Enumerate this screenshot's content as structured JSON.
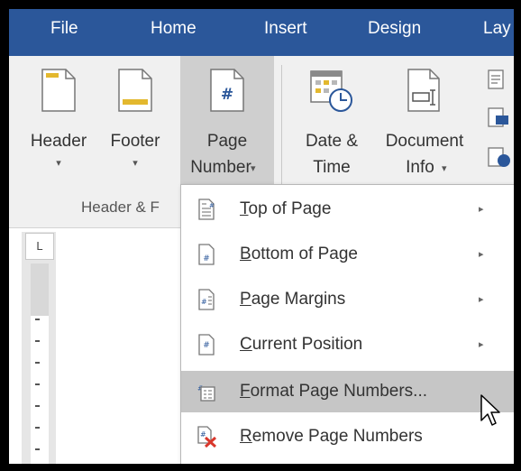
{
  "tabs": {
    "file": "File",
    "home": "Home",
    "insert": "Insert",
    "design": "Design",
    "layout": "Lay"
  },
  "ribbon": {
    "header": {
      "label": "Header"
    },
    "footer": {
      "label": "Footer"
    },
    "page_number": {
      "line1": "Page",
      "line2": "Number"
    },
    "date_time": {
      "line1": "Date &",
      "line2": "Time"
    },
    "doc_info": {
      "line1": "Document",
      "line2": "Info"
    },
    "group_label": "Header & F"
  },
  "ruler": {
    "corner": "L"
  },
  "menu": {
    "top_of_page": {
      "mnemonic": "T",
      "rest": "op of Page"
    },
    "bottom_of_page": {
      "mnemonic": "B",
      "rest": "ottom of Page"
    },
    "page_margins": {
      "mnemonic": "P",
      "rest": "age Margins"
    },
    "current_position": {
      "mnemonic": "C",
      "rest": "urrent Position"
    },
    "format_page_numbers": {
      "mnemonic": "F",
      "rest": "ormat Page Numbers..."
    },
    "remove_page_numbers": {
      "mnemonic": "R",
      "rest": "emove Page Numbers"
    }
  },
  "icons": {
    "submenu_arrow": "▸",
    "dropdown_arrow": "▾"
  },
  "colors": {
    "tab_bar": "#2b579a",
    "hover": "#c6c6c6",
    "remove_x": "#d9372c"
  }
}
